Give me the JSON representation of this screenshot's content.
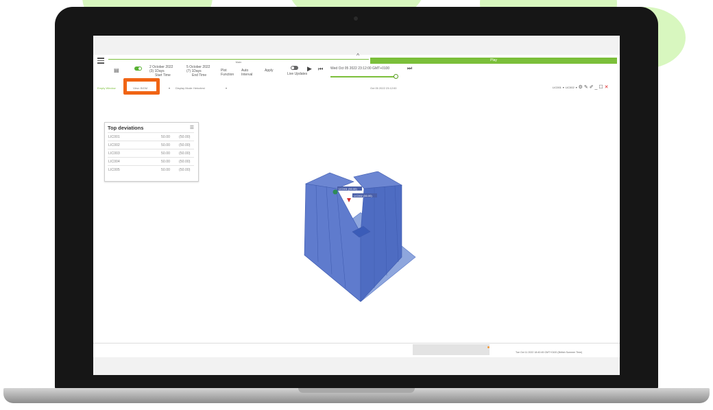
{
  "app": {
    "tab_main": "Main",
    "tab_play": "Play",
    "start_date": "2 October 2022",
    "end_date": "5 October 2022",
    "start_step": "(3) 1Days",
    "end_step": "(7) 1Days",
    "start_time_label": "Start Time",
    "end_time_label": "End Time",
    "function_value": "Plot",
    "function_label": "Function",
    "interval_value": "Auto",
    "interval_label": "Interval",
    "apply_label": "Apply",
    "live_updates_label": "Live Updates",
    "current_time": "Wed Oct 05 2022 23:12:00 GMT+0100",
    "empty_window": "Empty Window",
    "view_label": "View: BIGM",
    "display_mode_label": "Display Mode:",
    "display_mode_value": "Heinztest",
    "chart_timestamp": "Oct 05 2022 23:12:00",
    "user_select_1": "LIC001",
    "user_select_2": "LIC002",
    "timeline_label": "Tue Oct 11 2022 18:40:45 GMT+0100 (British Summer Time)"
  },
  "deviations": {
    "title": "Top deviations",
    "rows": [
      {
        "name": "LIC001",
        "value": "50.00",
        "bracket": "(50.00)"
      },
      {
        "name": "LIC002",
        "value": "50.00",
        "bracket": "(50.00)"
      },
      {
        "name": "LIC003",
        "value": "50.00",
        "bracket": "(50.00)"
      },
      {
        "name": "LIC004",
        "value": "50.00",
        "bracket": "(50.00)"
      },
      {
        "name": "LIC005",
        "value": "50.00",
        "bracket": "(50.00)"
      }
    ]
  },
  "markers": {
    "marker_1": "LIC001 (50.00)",
    "marker_2": "LIC002 (50.00)"
  },
  "colors": {
    "accent_green": "#7bbf3a",
    "highlight_orange": "#f06414",
    "surface_blue": "#5a78c8",
    "surface_light": "#8ea6dd"
  }
}
